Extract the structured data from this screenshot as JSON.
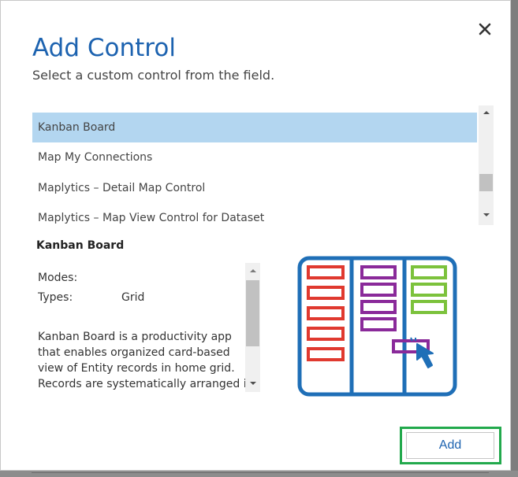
{
  "dialog": {
    "title": "Add Control",
    "subtitle": "Select a custom control from the field.",
    "close_icon": "close-icon"
  },
  "control_list": {
    "selected_index": 0,
    "items": [
      {
        "label": "Kanban Board"
      },
      {
        "label": "Map My Connections"
      },
      {
        "label": "Maplytics – Detail Map Control"
      },
      {
        "label": "Maplytics – Map View Control for Dataset"
      }
    ]
  },
  "detail": {
    "name": "Kanban Board",
    "modes_label": "Modes:",
    "modes_value": "",
    "types_label": "Types:",
    "types_value": "Grid",
    "description_lines": [
      "Kanban Board is a productivity app",
      "that enables organized card-based",
      "view of Entity records in home grid.",
      "Records are systematically arranged in"
    ],
    "illustration": "kanban-board-illustration"
  },
  "footer": {
    "add_label": "Add"
  },
  "colors": {
    "accent": "#1d63b0",
    "selected_row": "#b3d6f0",
    "highlight_outline": "#22a94c",
    "kanban_red": "#e0392f",
    "kanban_purple": "#8a2a9a",
    "kanban_green": "#7cc23c"
  }
}
